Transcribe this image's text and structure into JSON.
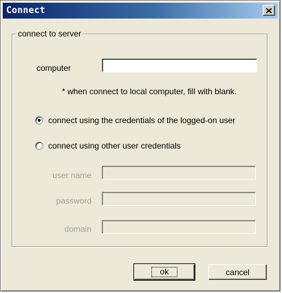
{
  "window": {
    "title": "Connect",
    "close_icon": "close-icon"
  },
  "group": {
    "legend": "connect to server"
  },
  "computer": {
    "label": "computer",
    "value": "",
    "hint": "* when connect to local computer, fill with blank."
  },
  "credentials": {
    "option_logged_on": "connect using the credentials of the logged-on user",
    "option_other": "connect using other user credentials",
    "selected": "logged_on"
  },
  "fields": {
    "user_name_label": "user name",
    "user_name_value": "",
    "password_label": "password",
    "password_value": "",
    "domain_label": "domain",
    "domain_value": ""
  },
  "buttons": {
    "ok": "ok",
    "cancel": "cancel"
  }
}
